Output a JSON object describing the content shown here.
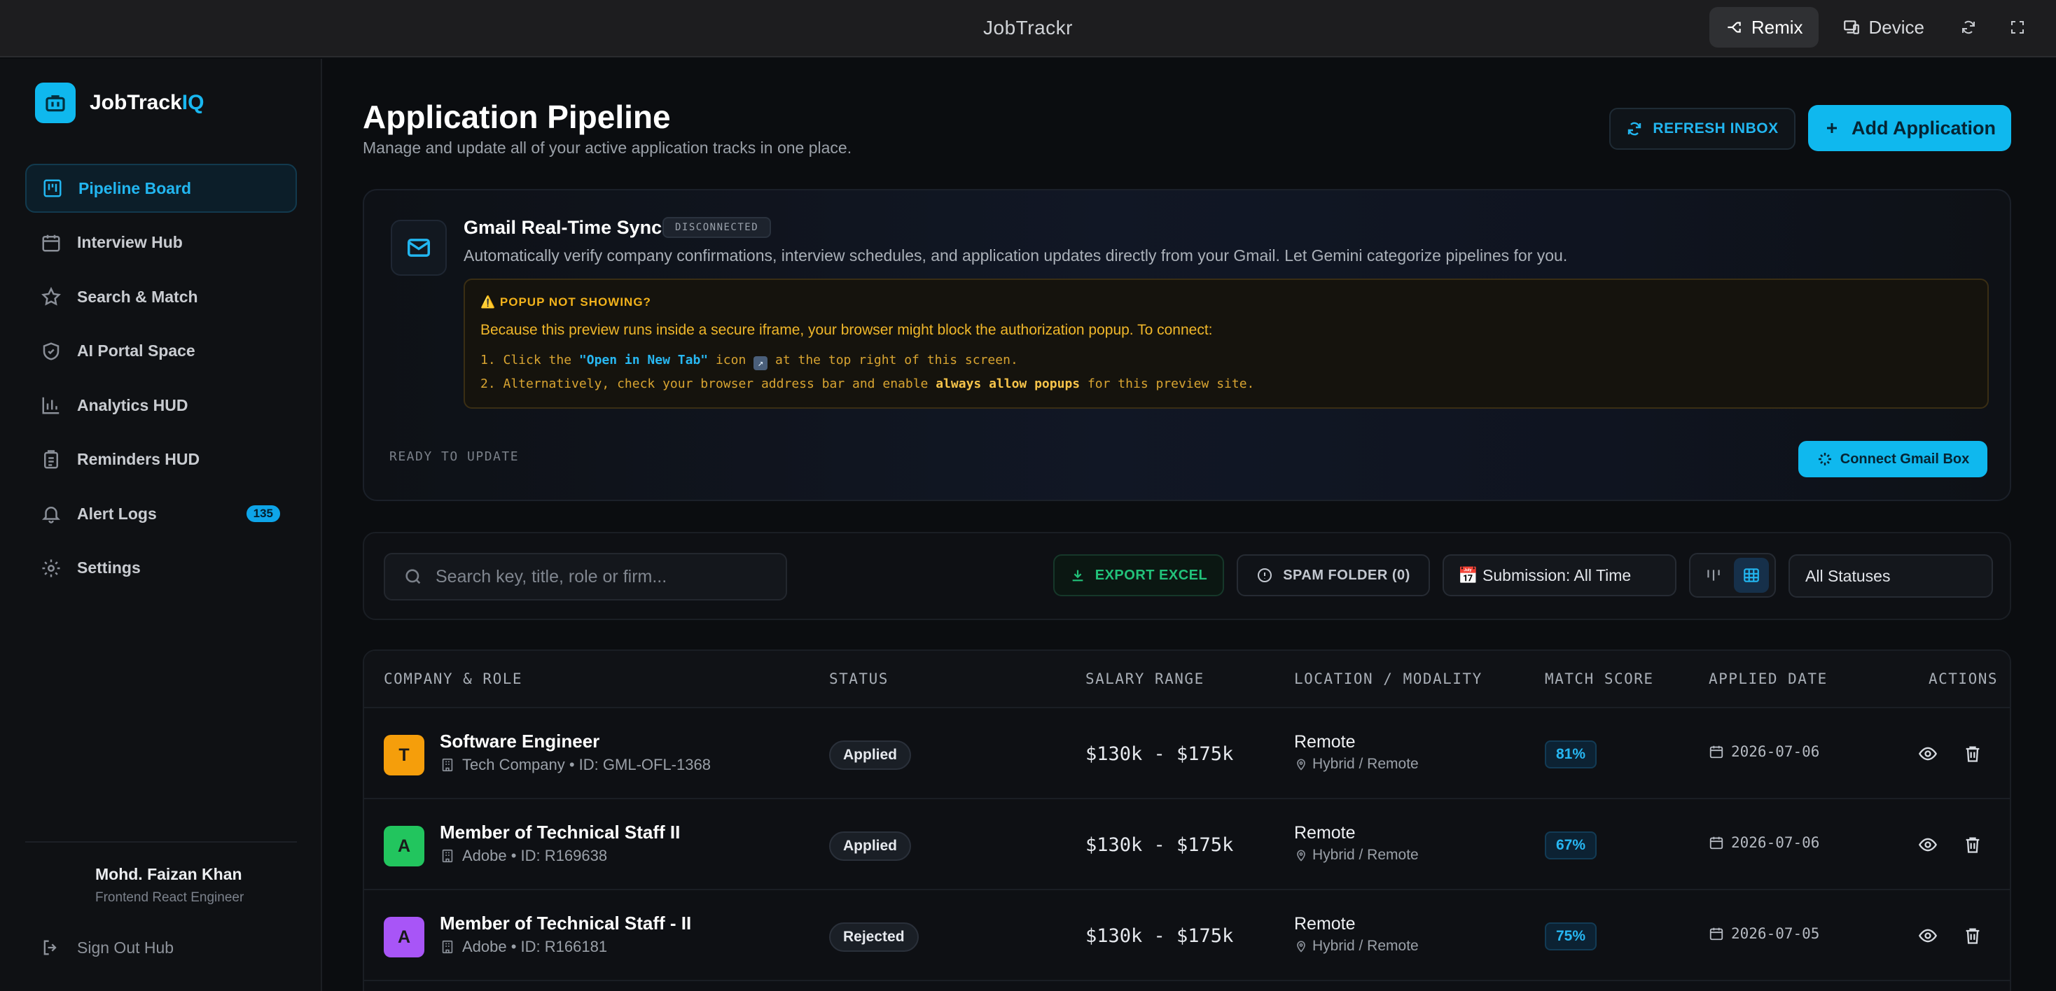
{
  "window": {
    "title": "JobTrackr",
    "remix_label": "Remix",
    "device_label": "Device"
  },
  "brand": {
    "name_main": "JobTrack",
    "name_accent": "IQ"
  },
  "nav": [
    {
      "label": "Pipeline Board",
      "icon": "kanban-icon",
      "active": true
    },
    {
      "label": "Interview Hub",
      "icon": "calendar-icon"
    },
    {
      "label": "Search & Match",
      "icon": "star-icon"
    },
    {
      "label": "AI Portal Space",
      "icon": "shield-icon"
    },
    {
      "label": "Analytics HUD",
      "icon": "bar-chart-icon"
    },
    {
      "label": "Reminders HUD",
      "icon": "clipboard-icon"
    },
    {
      "label": "Alert Logs",
      "icon": "bell-icon",
      "badge": "135"
    },
    {
      "label": "Settings",
      "icon": "gear-icon"
    }
  ],
  "user": {
    "name": "Mohd. Faizan Khan",
    "role": "Frontend React Engineer",
    "signout_label": "Sign Out Hub"
  },
  "header": {
    "title": "Application Pipeline",
    "subtitle": "Manage and update all of your active application tracks in one place.",
    "refresh_label": "REFRESH INBOX",
    "add_label": "Add Application"
  },
  "gmail": {
    "title": "Gmail Real-Time Sync",
    "status": "DISCONNECTED",
    "description": "Automatically verify company confirmations, interview schedules, and application updates directly from your Gmail. Let Gemini categorize pipelines for you.",
    "popup_head": "⚠️ POPUP NOT SHOWING?",
    "popup_text": "Because this preview runs inside a secure iframe, your browser might block the authorization popup. To connect:",
    "step1_pre": "1. Click the ",
    "step1_hl": "\"Open in New Tab\"",
    "step1_mid": " icon ",
    "step1_post": " at the top right of this screen.",
    "step2_pre": "2. Alternatively, check your browser address bar and enable ",
    "step2_hl": "always allow popups",
    "step2_post": " for this preview site.",
    "ready": "READY TO UPDATE",
    "connect_label": "Connect Gmail Box"
  },
  "filters": {
    "search_placeholder": "Search key, title, role or firm...",
    "export_label": "EXPORT EXCEL",
    "spam_label": "SPAM FOLDER (0)",
    "date_label": "📅 Submission: All Time",
    "status_label": "All Statuses"
  },
  "table": {
    "headers": [
      "COMPANY & ROLE",
      "STATUS",
      "SALARY RANGE",
      "LOCATION / MODALITY",
      "MATCH SCORE",
      "APPLIED DATE",
      "ACTIONS"
    ],
    "rows": [
      {
        "initial": "T",
        "color": "#f59e0b",
        "title": "Software Engineer",
        "meta": "Tech Company • ID: GML-OFL-1368",
        "status": "Applied",
        "salary": "$130k - $175k",
        "location": "Remote",
        "modality": "Hybrid / Remote",
        "match": "81%",
        "date": "2026-07-06"
      },
      {
        "initial": "A",
        "color": "#22c55e",
        "title": "Member of Technical Staff II",
        "meta": "Adobe • ID: R169638",
        "status": "Applied",
        "salary": "$130k - $175k",
        "location": "Remote",
        "modality": "Hybrid / Remote",
        "match": "67%",
        "date": "2026-07-06"
      },
      {
        "initial": "A",
        "color": "#a855f7",
        "title": "Member of Technical Staff - II",
        "meta": "Adobe • ID: R166181",
        "status": "Rejected",
        "salary": "$130k - $175k",
        "location": "Remote",
        "modality": "Hybrid / Remote",
        "match": "75%",
        "date": "2026-07-05"
      }
    ]
  }
}
